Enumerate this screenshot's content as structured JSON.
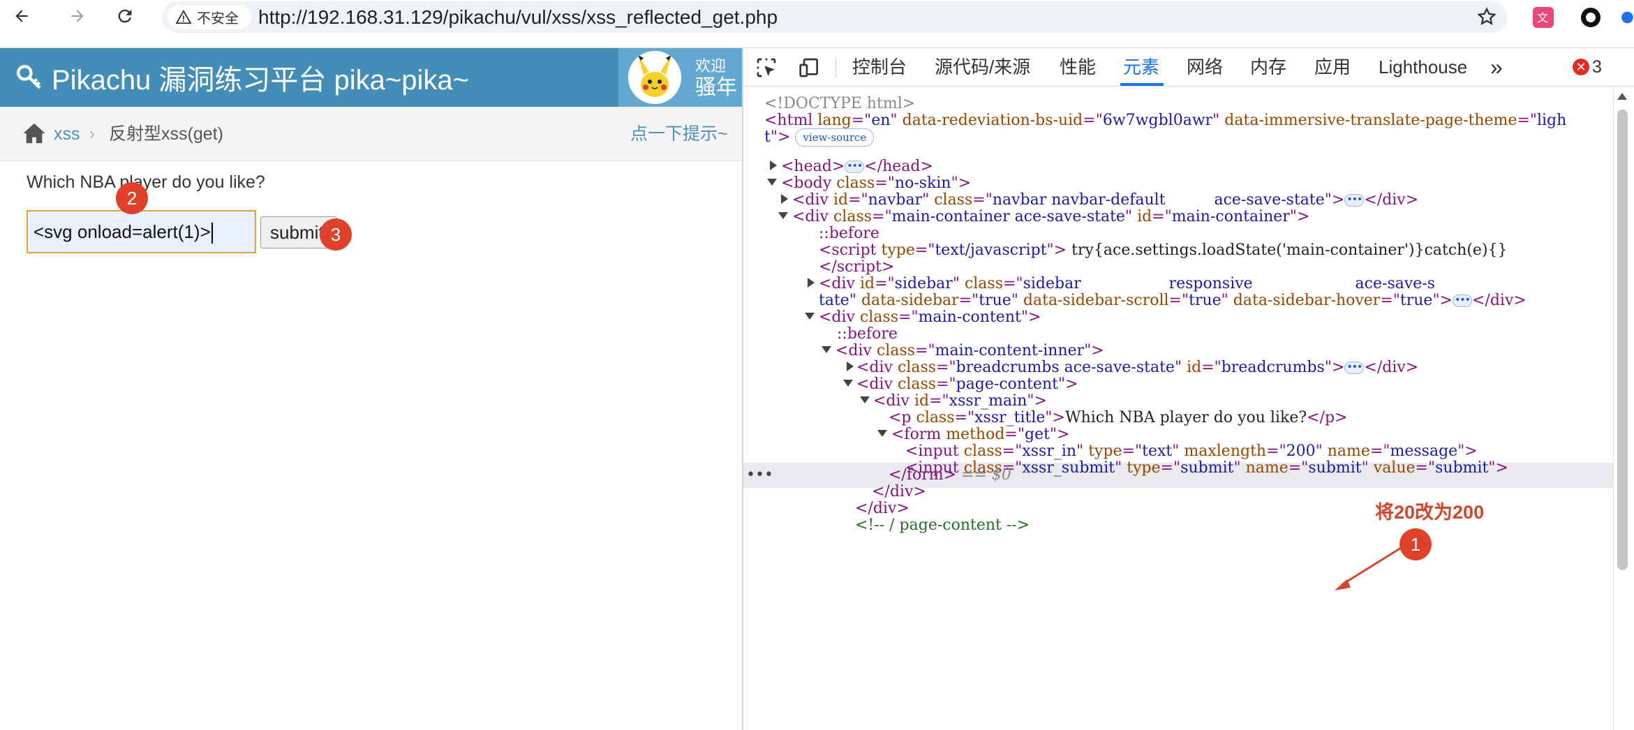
{
  "browser": {
    "back_icon": "arrow-left-icon",
    "forward_icon": "arrow-right-icon",
    "reload_icon": "reload-icon",
    "security_label": "不安全",
    "url": "http://192.168.31.129/pikachu/vul/xss/xss_reflected_get.php"
  },
  "site": {
    "brand_title": "Pikachu 漏洞练习平台 pika~pika~",
    "welcome": "欢迎",
    "username": "骚年"
  },
  "breadcrumbs": {
    "link": "xss",
    "separator": "›",
    "current": "反射型xss(get)",
    "hint": "点一下提示~"
  },
  "form": {
    "question": "Which NBA player do you like?",
    "input_value": "<svg onload=alert(1)>",
    "submit_label": "submit"
  },
  "markers": {
    "m1": "1",
    "m2": "2",
    "m3": "3",
    "annotation_text": "将20改为200"
  },
  "devtools": {
    "tabs": [
      "控制台",
      "源代码/来源",
      "性能",
      "元素",
      "网络",
      "内存",
      "应用",
      "Lighthouse"
    ],
    "active_tab": "元素",
    "more": "»",
    "error_count": "3",
    "dom": {
      "doctype": "<!DOCTYPE html>",
      "html_lang": "en",
      "html_uid": "6w7wgbl0awr",
      "html_theme": "ligh",
      "html_theme_tail": "t",
      "view_source": "view-source",
      "body_class": "no-skin",
      "navbar_id": "navbar",
      "navbar_class": "navbar navbar-default          ace-save-state",
      "main_container_class": "main-container ace-save-state",
      "main_container_id": "main-container",
      "before": "::before",
      "script_type": "text/javascript",
      "script_text": " try{ace.settings.loadState('main-container')}catch(e){}",
      "sidebar_id": "sidebar",
      "sidebar_class_a": "sidebar                  responsive                     ace-save-s",
      "sidebar_class_b": "tate",
      "data_sidebar": "true",
      "data_sidebar_scroll": "true",
      "data_sidebar_hover": "true",
      "main_content_class": "main-content",
      "main_content_inner_class": "main-content-inner",
      "breadcrumbs_class": "breadcrumbs ace-save-state",
      "breadcrumbs_id": "breadcrumbs",
      "page_content_class": "page-content",
      "xssr_main_id": "xssr_main",
      "p_class": "xssr_title",
      "p_text": "Which NBA player do you like?",
      "form_method": "get",
      "input_class": "xssr_in",
      "input_type": "text",
      "input_maxlength": "200",
      "input_name": "message",
      "submit_class": "xssr_submit",
      "submit_type": "submit",
      "submit_name": "submit",
      "submit_value": "submit",
      "dollar_ref": " == $0",
      "comment": "<!-- / page-content -->"
    }
  }
}
